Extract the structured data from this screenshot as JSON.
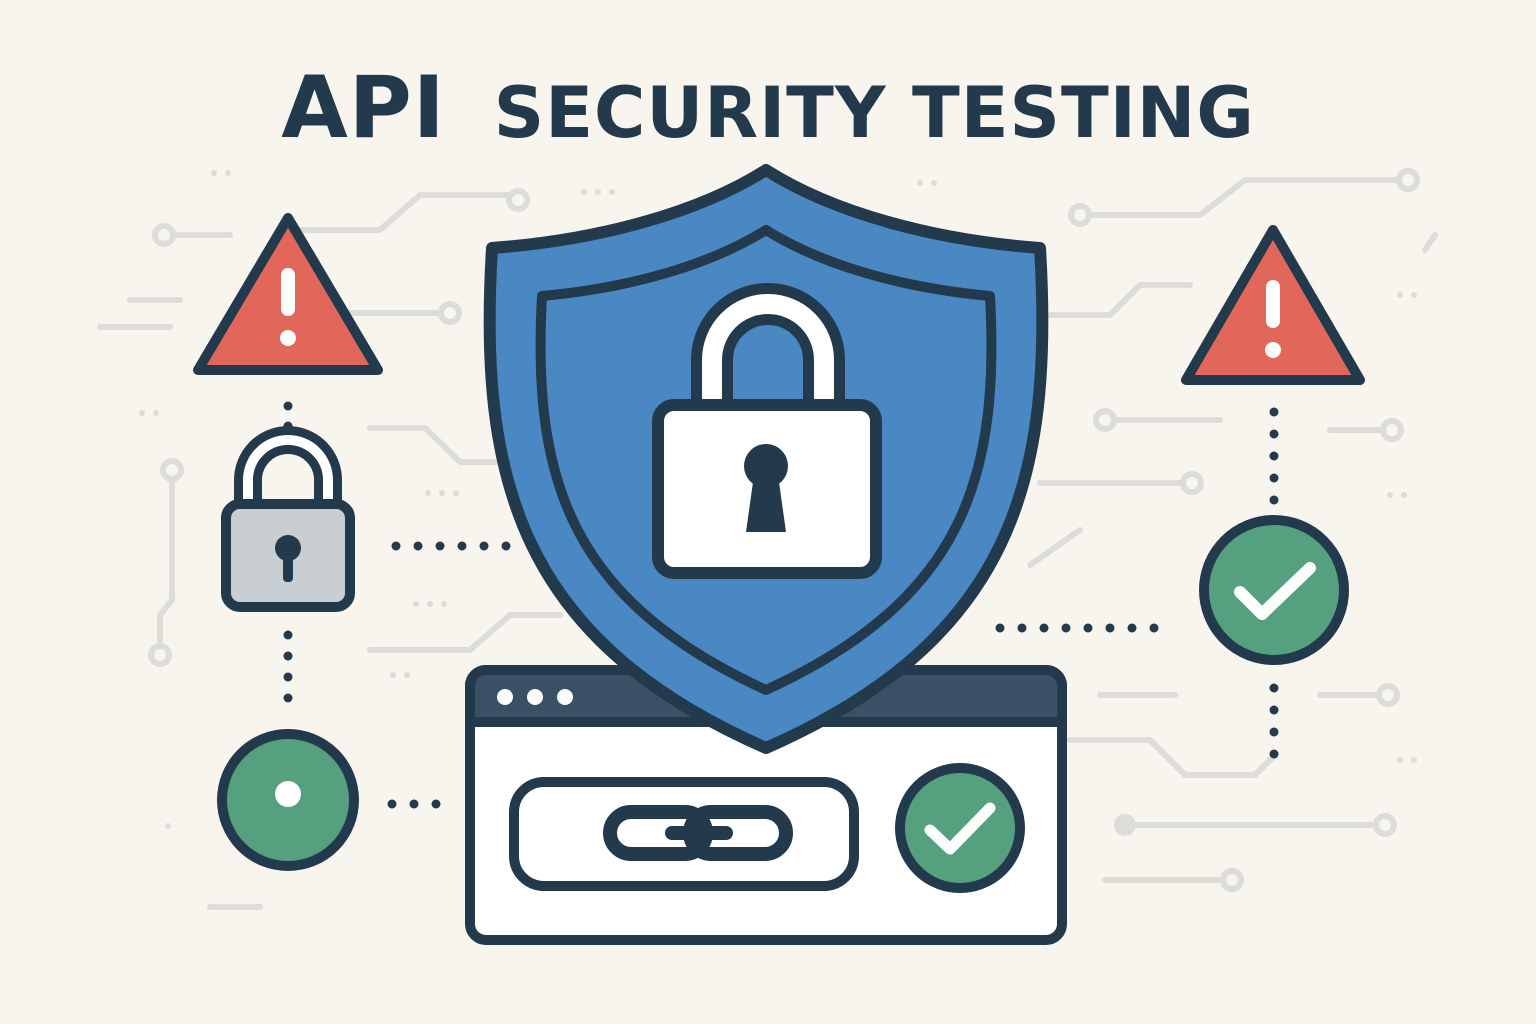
{
  "title": {
    "part1": "API",
    "part2": "SECURITY TESTING"
  },
  "colors": {
    "background": "#f8f5ef",
    "outline": "#223a4c",
    "shield_blue": "#4a88c4",
    "warning_red": "#e0675a",
    "success_green": "#55a07f",
    "lock_gray": "#c9ced2",
    "window_bar": "#3a5165",
    "circuit_gray": "#dcdcd8"
  },
  "icons": {
    "shield": "shield-icon",
    "main_lock": "padlock-icon",
    "warning": "warning-triangle-icon",
    "small_lock": "small-padlock-icon",
    "success": "check-circle-icon",
    "status": "status-dot-icon",
    "link": "chain-link-icon",
    "window": "browser-window-icon"
  }
}
